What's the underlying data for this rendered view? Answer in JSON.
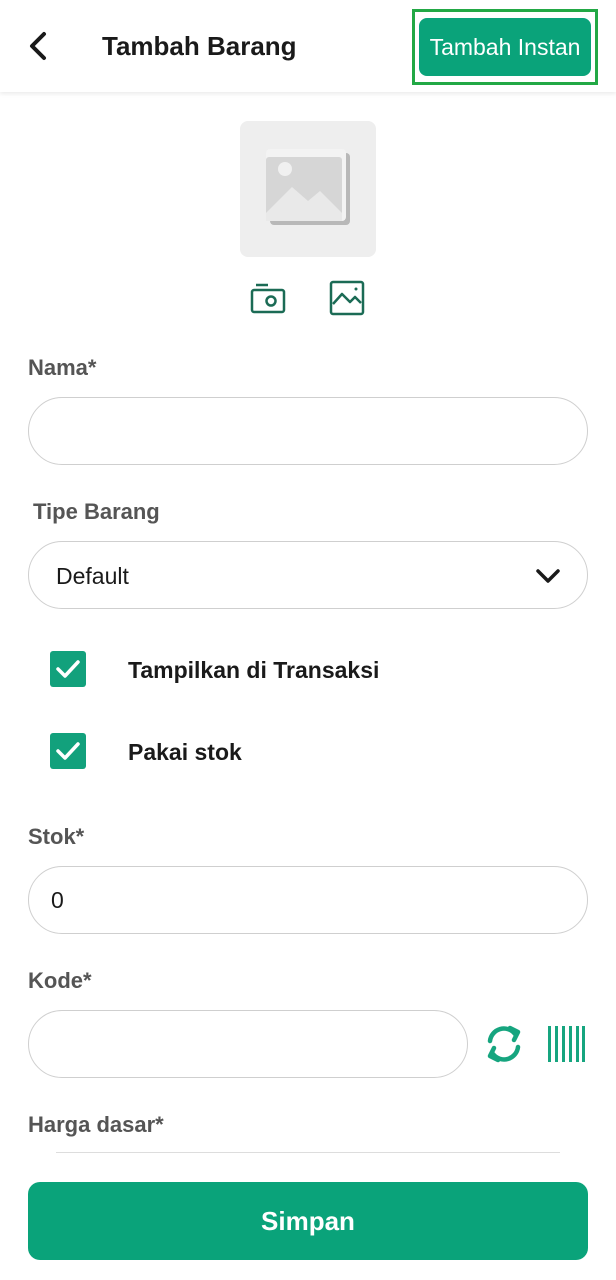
{
  "header": {
    "title": "Tambah Barang",
    "instant_button": "Tambah Instan",
    "back_icon": "chevron-left-icon"
  },
  "photo": {
    "placeholder_icon": "image-placeholder-icon",
    "camera_icon": "camera-icon",
    "gallery_icon": "gallery-icon"
  },
  "form": {
    "name": {
      "label": "Nama*",
      "value": "",
      "placeholder": ""
    },
    "type": {
      "label": "Tipe Barang",
      "value": "Default",
      "icon": "chevron-down-icon"
    },
    "show_in_transaction": {
      "label": "Tampilkan di Transaksi",
      "checked": true
    },
    "use_stock": {
      "label": "Pakai stok",
      "checked": true
    },
    "stock": {
      "label": "Stok*",
      "value": "0"
    },
    "code": {
      "label": "Kode*",
      "value": "",
      "refresh_icon": "refresh-icon",
      "barcode_icon": "barcode-icon"
    },
    "base_price": {
      "label": "Harga dasar*"
    }
  },
  "footer": {
    "save_button": "Simpan"
  },
  "colors": {
    "accent": "#0aa37a",
    "highlight_border": "#22a845",
    "label": "#555555",
    "field_border": "#cfcfcf"
  }
}
